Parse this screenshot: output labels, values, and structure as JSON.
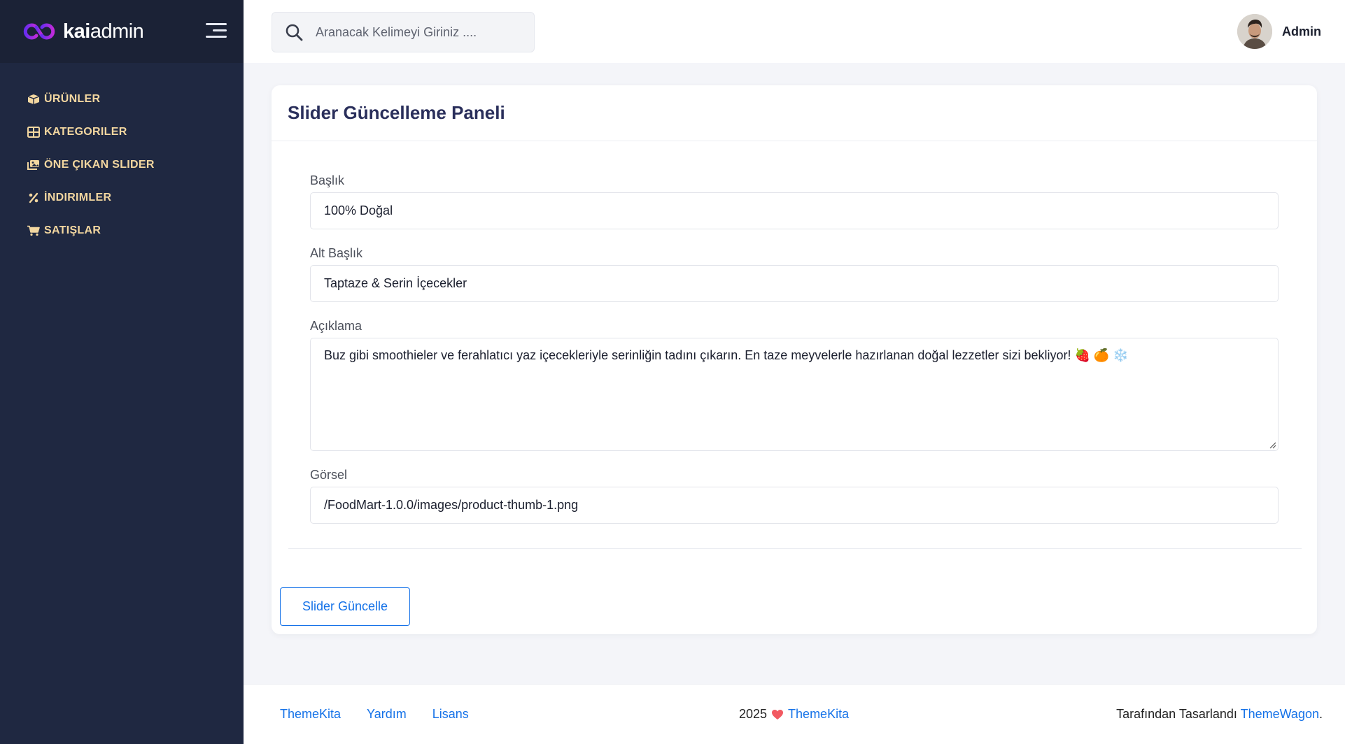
{
  "sidebar": {
    "logo": {
      "bold": "kai",
      "regular": "admin"
    },
    "items": [
      {
        "label": "ÜRÜNLER",
        "icon": "box-icon"
      },
      {
        "label": "KATEGORILER",
        "icon": "grid-icon"
      },
      {
        "label": "ÖNE ÇIKAN SLIDER",
        "icon": "images-icon"
      },
      {
        "label": "İNDIRIMLER",
        "icon": "percent-icon"
      },
      {
        "label": "SATIŞLAR",
        "icon": "cart-icon"
      }
    ]
  },
  "topbar": {
    "search_placeholder": "Aranacak Kelimeyi Giriniz ....",
    "user_name": "Admin"
  },
  "card": {
    "title": "Slider Güncelleme Paneli",
    "fields": {
      "title_label": "Başlık",
      "title_value": "100% Doğal",
      "subtitle_label": "Alt Başlık",
      "subtitle_value": "Taptaze & Serin İçecekler",
      "description_label": "Açıklama",
      "description_value": "Buz gibi smoothieler ve ferahlatıcı yaz içecekleriyle serinliğin tadını çıkarın. En taze meyvelerle hazırlanan doğal lezzetler sizi bekliyor! 🍓 🍊 ❄️",
      "image_label": "Görsel",
      "image_value": "/FoodMart-1.0.0/images/product-thumb-1.png"
    },
    "submit_label": "Slider Güncelle"
  },
  "footer": {
    "links": [
      "ThemeKita",
      "Yardım",
      "Lisans"
    ],
    "year": "2025",
    "brand": "ThemeKita",
    "designed_by_text": "Tarafından Tasarlandı ",
    "designed_by_link": "ThemeWagon",
    "designed_by_suffix": "."
  },
  "colors": {
    "sidebar_bg": "#1f2841",
    "nav_text": "#f3d7a0",
    "accent": "#1572e8",
    "heart": "#f25961"
  }
}
